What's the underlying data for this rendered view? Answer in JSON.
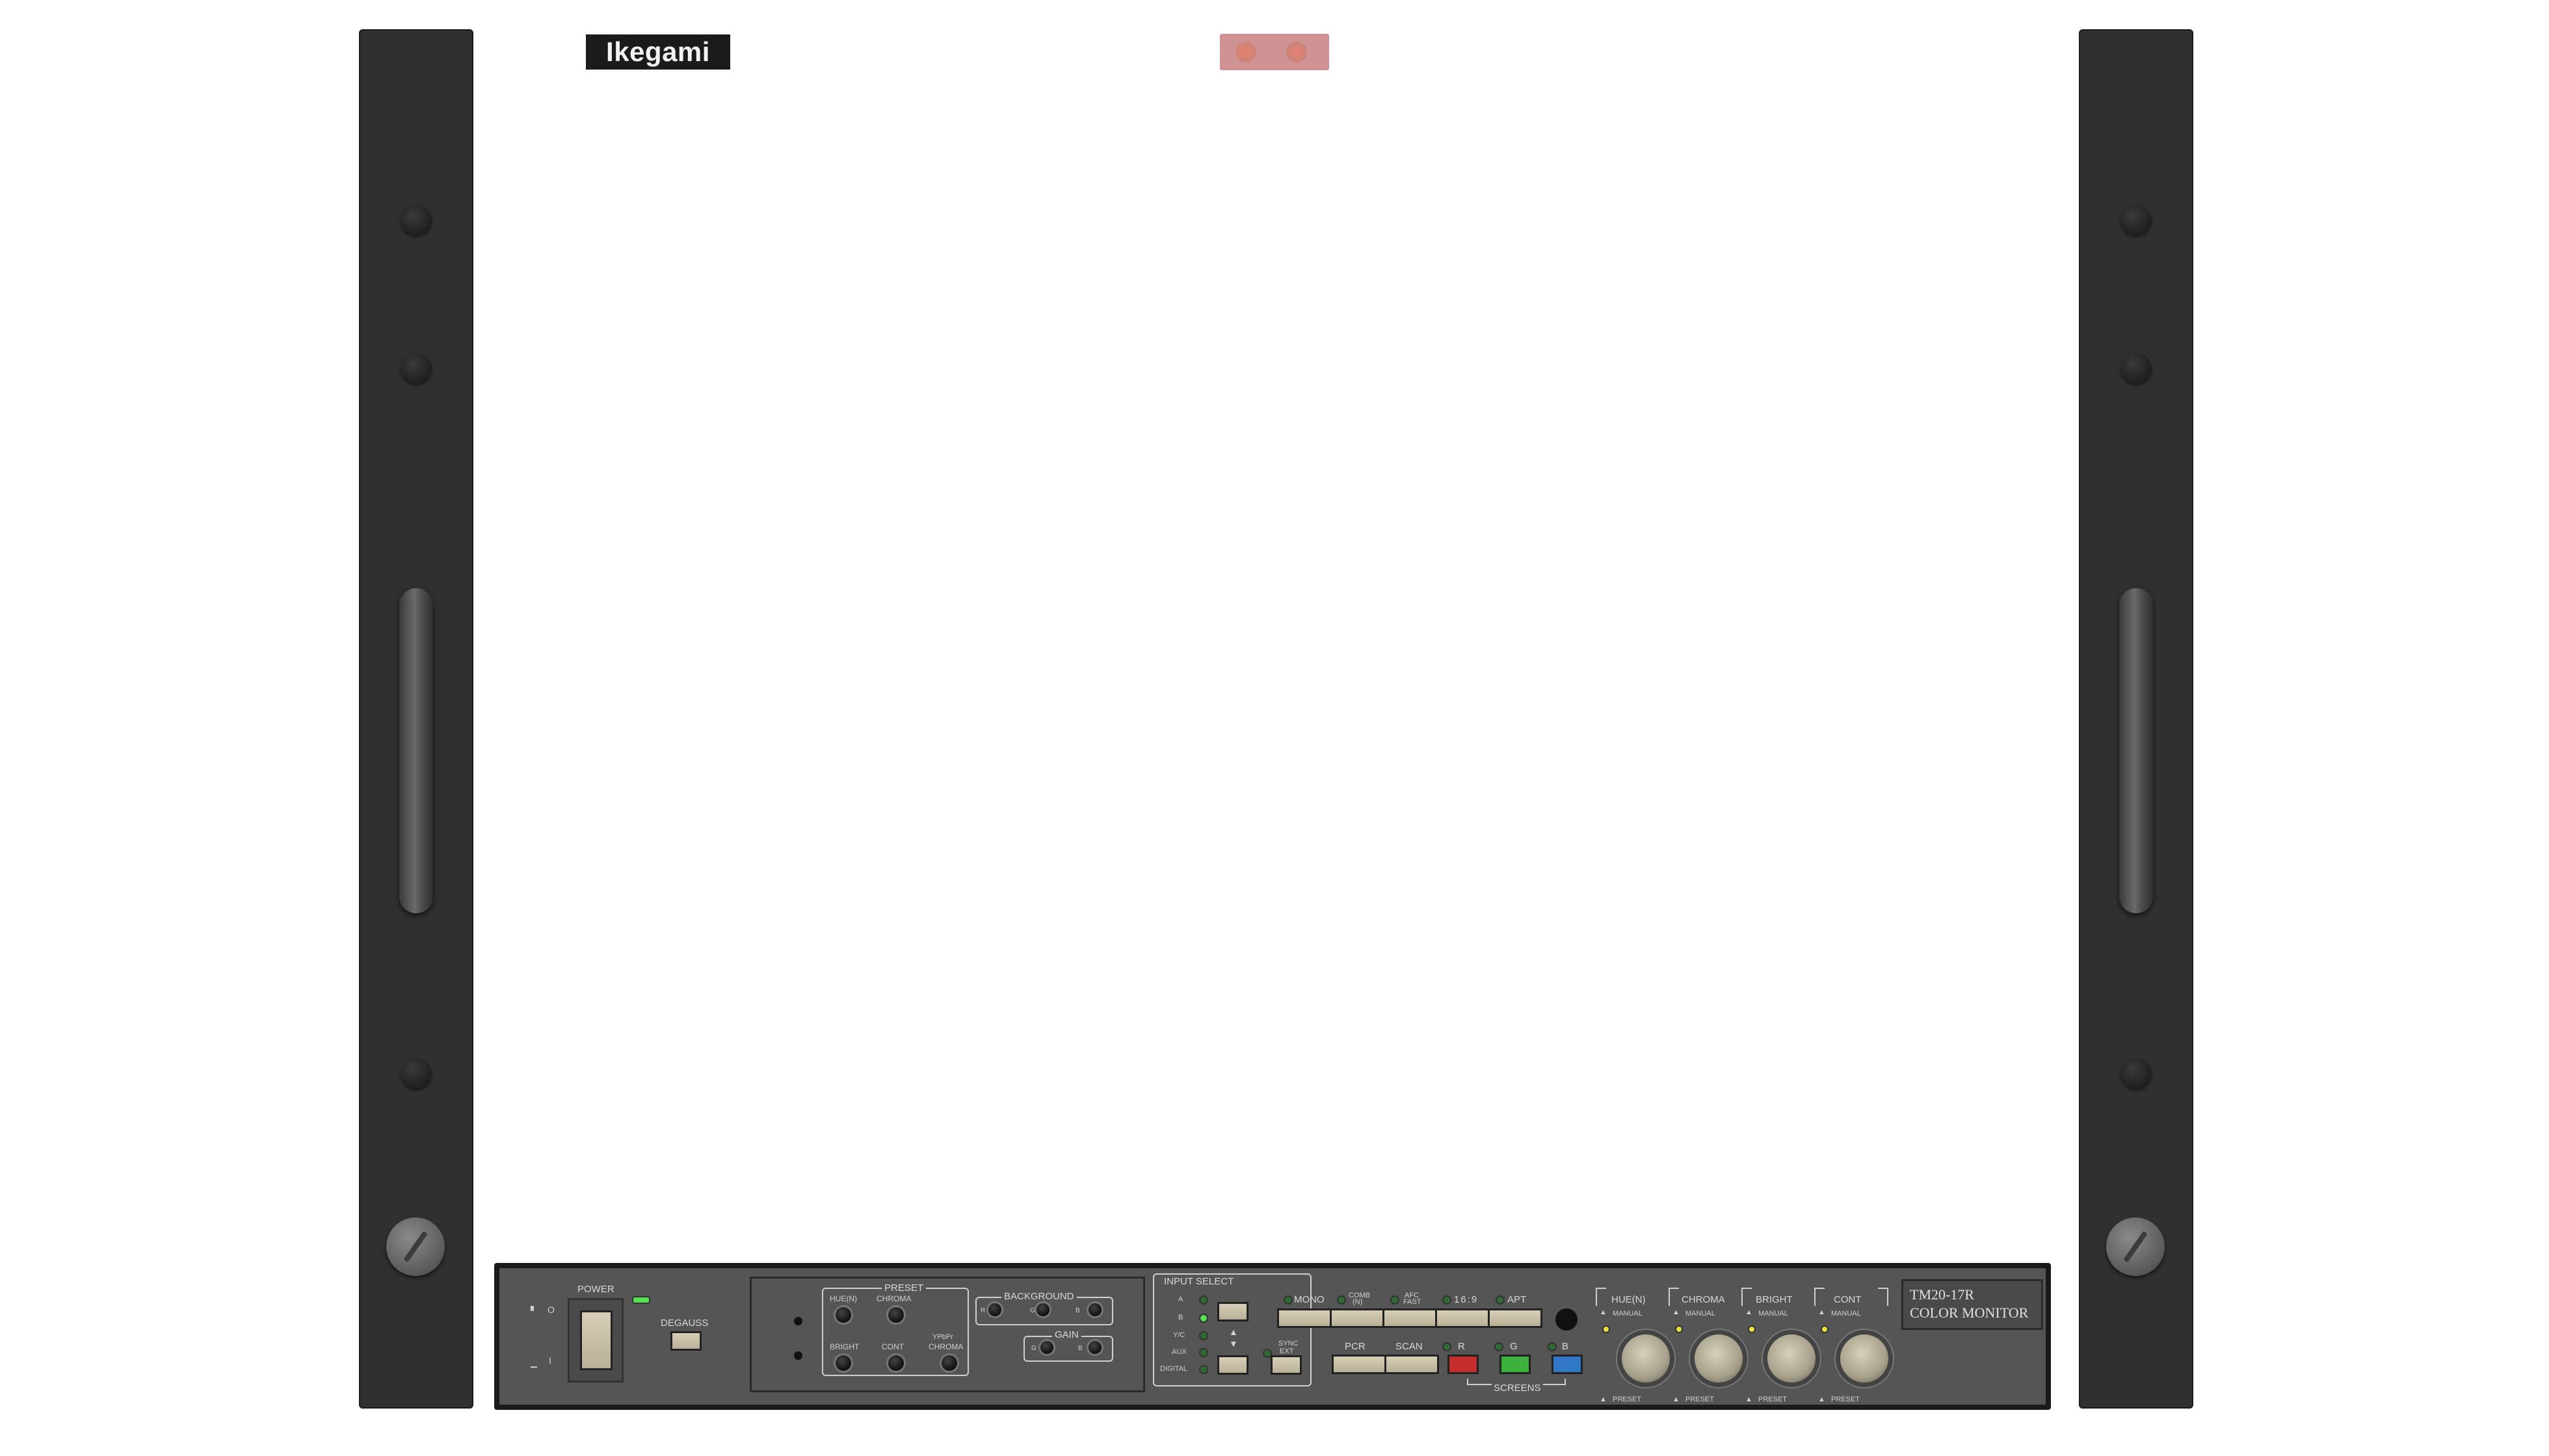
{
  "brand": {
    "logo_text": "Ikegami"
  },
  "power": {
    "label": "POWER",
    "on_symbol": "I",
    "off_symbol": "O"
  },
  "degauss": {
    "label": "DEGAUSS"
  },
  "preset": {
    "title": "PRESET",
    "hue": "HUE(N)",
    "chroma": "CHROMA",
    "bright": "BRIGHT",
    "cont": "CONT",
    "ypbpr_top": "YPbPr",
    "ypbpr_bottom": "CHROMA"
  },
  "background": {
    "title": "BACKGROUND",
    "r": "R",
    "g": "G",
    "b": "B"
  },
  "gain": {
    "title": "GAIN",
    "g": "G",
    "b": "B"
  },
  "input_select": {
    "title": "INPUT SELECT",
    "inputs": [
      "A",
      "B",
      "Y/C",
      "AUX",
      "DIGITAL"
    ],
    "active_index": 1,
    "up_arrow": "▲",
    "down_arrow": "▼",
    "sync_ext_top": "SYNC",
    "sync_ext_bottom": "EXT"
  },
  "functions": {
    "mono": "MONO",
    "comb_top": "COMB",
    "comb_bottom": "(N)",
    "afc_top": "AFC",
    "afc_bottom": "FAST",
    "aspect": "16:9",
    "apt": "APT",
    "pcr": "PCR",
    "scan": "SCAN",
    "r": "R",
    "g": "G",
    "b": "B",
    "screens": "SCREENS"
  },
  "knobs": [
    {
      "title": "HUE(N)",
      "manual": "MANUAL",
      "preset": "PRESET"
    },
    {
      "title": "CHROMA",
      "manual": "MANUAL",
      "preset": "PRESET"
    },
    {
      "title": "BRIGHT",
      "manual": "MANUAL",
      "preset": "PRESET"
    },
    {
      "title": "CONT",
      "manual": "MANUAL",
      "preset": "PRESET"
    }
  ],
  "model": {
    "line1": "TM20-17R",
    "line2": "COLOR MONITOR"
  },
  "colors": {
    "ear": "#303030",
    "panel": "#555555",
    "button": "#c9c0a8",
    "led_green": "#55e055",
    "btn_red": "#c62e2e",
    "btn_green": "#3cb23c",
    "btn_blue": "#2f78c8"
  }
}
